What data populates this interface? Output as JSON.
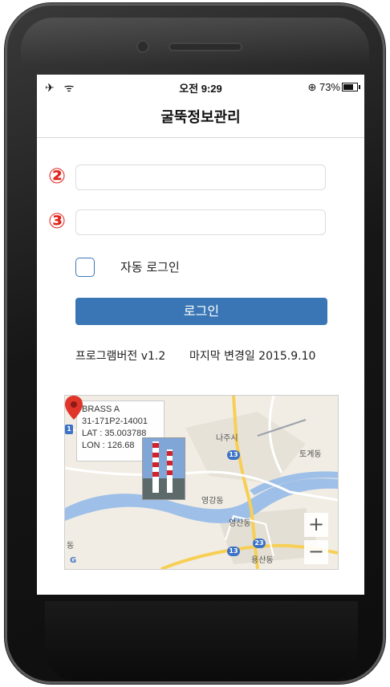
{
  "status_bar": {
    "left_icons": "✈ ᯤ",
    "time": "오전 9:29",
    "battery_text": "⊕ 73%",
    "battery_level": 0.73
  },
  "header": {
    "title": "굴뚝정보관리"
  },
  "form": {
    "field1_marker": "②",
    "field2_marker": "③",
    "field1_value": "",
    "field2_value": "",
    "auto_login_label": "자동 로그인",
    "login_button": "로그인"
  },
  "footer_info": {
    "version": "프로그램버전 v1.2",
    "last_changed": "마지막 변경일 2015.9.10"
  },
  "map": {
    "info": {
      "name": "BRASS A",
      "code": "31-171P2-14001",
      "lat": "LAT : 35.003788",
      "lon": "LON : 126.68"
    },
    "labels": {
      "najusi": "나주시",
      "tohgyedong": "토계동",
      "yeonggangdong": "영강동",
      "yeongsandong": "영산동",
      "yongsandong": "용산동",
      "left_dong": "동"
    },
    "shields": {
      "a": "1",
      "b": "13",
      "c": "23",
      "d": "13"
    },
    "zoom_in": "+",
    "zoom_out": "−"
  }
}
